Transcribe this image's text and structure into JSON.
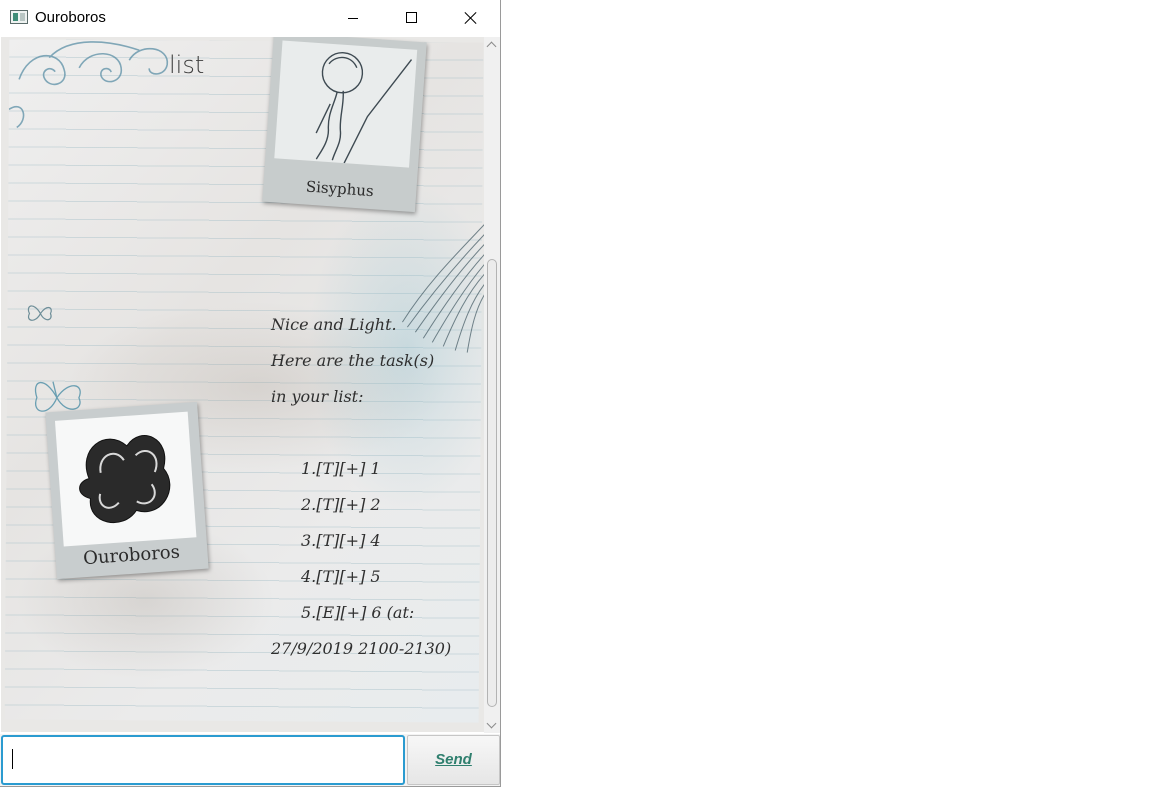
{
  "window": {
    "title": "Ouroboros",
    "controls": [
      "minimize",
      "maximize",
      "close"
    ]
  },
  "chat": {
    "user": {
      "avatar_caption": "Sisyphus",
      "message": "list"
    },
    "bot": {
      "avatar_caption": "Ouroboros",
      "lines": [
        "Nice and Light.",
        "Here are the task(s)",
        "in your list:",
        "",
        "1.[T][+] 1",
        "2.[T][+] 2",
        "3.[T][+] 4",
        "4.[T][+] 5",
        "5.[E][+] 6 (at:",
        "27/9/2019 2100-2130)"
      ]
    }
  },
  "input": {
    "value": "",
    "send_label": "Send"
  },
  "colors": {
    "accent": "#2b9bd0",
    "send_text": "#2f7f6e"
  },
  "icons": {
    "app": "app-window-icon",
    "minimize": "minimize-icon",
    "maximize": "maximize-icon",
    "close": "close-icon"
  }
}
